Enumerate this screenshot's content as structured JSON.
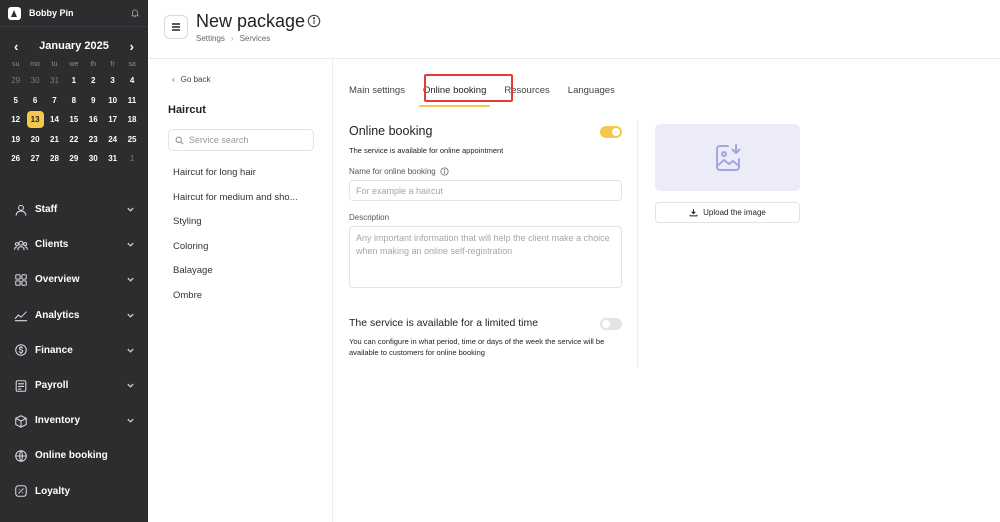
{
  "app": {
    "user_name": "Bobby Pin"
  },
  "calendar": {
    "month_label": "January 2025",
    "prev_label": "‹",
    "next_label": "›",
    "weekdays": [
      "su",
      "mo",
      "tu",
      "we",
      "th",
      "fr",
      "sa"
    ],
    "weeks": [
      [
        {
          "d": "29",
          "dim": true
        },
        {
          "d": "30",
          "dim": true
        },
        {
          "d": "31",
          "dim": true
        },
        {
          "d": "1"
        },
        {
          "d": "2"
        },
        {
          "d": "3"
        },
        {
          "d": "4"
        }
      ],
      [
        {
          "d": "5"
        },
        {
          "d": "6"
        },
        {
          "d": "7"
        },
        {
          "d": "8"
        },
        {
          "d": "9"
        },
        {
          "d": "10"
        },
        {
          "d": "11"
        }
      ],
      [
        {
          "d": "12"
        },
        {
          "d": "13",
          "today": true
        },
        {
          "d": "14"
        },
        {
          "d": "15"
        },
        {
          "d": "16"
        },
        {
          "d": "17"
        },
        {
          "d": "18"
        }
      ],
      [
        {
          "d": "19"
        },
        {
          "d": "20"
        },
        {
          "d": "21"
        },
        {
          "d": "22"
        },
        {
          "d": "23"
        },
        {
          "d": "24"
        },
        {
          "d": "25"
        }
      ],
      [
        {
          "d": "26"
        },
        {
          "d": "27"
        },
        {
          "d": "28"
        },
        {
          "d": "29"
        },
        {
          "d": "30"
        },
        {
          "d": "31"
        },
        {
          "d": "1",
          "dim": true
        }
      ]
    ]
  },
  "nav": [
    {
      "label": "Staff",
      "icon": "user-icon",
      "chevron": true
    },
    {
      "label": "Clients",
      "icon": "clients-icon",
      "chevron": true
    },
    {
      "label": "Overview",
      "icon": "grid-icon",
      "chevron": true
    },
    {
      "label": "Analytics",
      "icon": "analytics-icon",
      "chevron": true
    },
    {
      "label": "Finance",
      "icon": "finance-icon",
      "chevron": true
    },
    {
      "label": "Payroll",
      "icon": "payroll-icon",
      "chevron": true
    },
    {
      "label": "Inventory",
      "icon": "inventory-icon",
      "chevron": true
    },
    {
      "label": "Online booking",
      "icon": "globe-icon",
      "chevron": false
    },
    {
      "label": "Loyalty",
      "icon": "loyalty-icon",
      "chevron": false
    }
  ],
  "header": {
    "title": "New package",
    "breadcrumb": [
      "Settings",
      "Services"
    ]
  },
  "service_panel": {
    "go_back": "Go back",
    "title": "Haircut",
    "search_placeholder": "Service search",
    "items": [
      "Haircut for long hair",
      "Haircut for medium and sho...",
      "Styling",
      "Coloring",
      "Balayage",
      "Ombre"
    ]
  },
  "tabs": [
    {
      "label": "Main settings",
      "active": false
    },
    {
      "label": "Online booking",
      "active": true
    },
    {
      "label": "Resources",
      "active": false
    },
    {
      "label": "Languages",
      "active": false
    }
  ],
  "online_booking": {
    "title": "Online booking",
    "subtitle": "The service is available for online appointment",
    "enabled": true,
    "name_label": "Name for online booking",
    "name_value": "",
    "name_placeholder": "For example a haircut",
    "description_label": "Description",
    "description_value": "",
    "description_placeholder": "Any important information that will help the client make a choice when making an online self-registration",
    "limited_title": "The service is available for a limited time",
    "limited_enabled": false,
    "limited_desc": "You can configure in what period, time or days of the week the service will be available to customers for online booking"
  },
  "image": {
    "upload_label": "Upload the image"
  },
  "colors": {
    "accent": "#f2c94c",
    "sidebar": "#2c2d2f",
    "highlight": "#e53935"
  }
}
